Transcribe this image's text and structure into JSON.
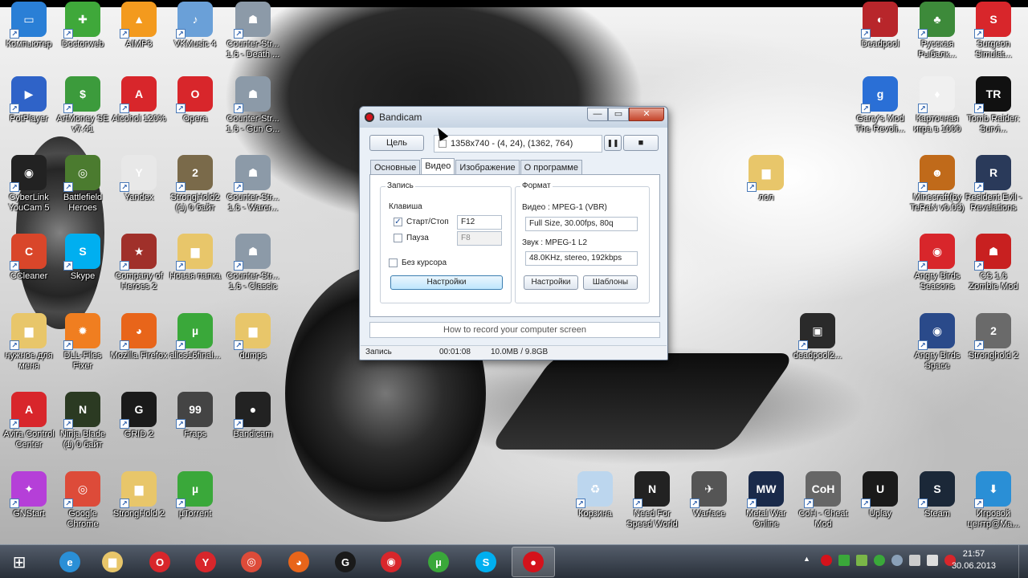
{
  "desktop": {
    "icons": [
      {
        "label": "Компьютер",
        "color": "#2a7fd6",
        "glyph": "▭"
      },
      {
        "label": "Doctorweb",
        "color": "#3fa83a",
        "glyph": "✚"
      },
      {
        "label": "AIMP3",
        "color": "#f39a1e",
        "glyph": "▲"
      },
      {
        "label": "VKMusic 4",
        "color": "#6aa0d8",
        "glyph": "♪"
      },
      {
        "label": "Counter-Str... 1.6 - Death ...",
        "color": "#8c9aa8",
        "glyph": "☗"
      },
      {
        "label": "PotPlayer",
        "color": "#2f63c8",
        "glyph": "▶"
      },
      {
        "label": "ArtMoney SE v7.41",
        "color": "#3c9b3c",
        "glyph": "$"
      },
      {
        "label": "Alcohol 120%",
        "color": "#d8262b",
        "glyph": "A"
      },
      {
        "label": "Opera",
        "color": "#d8262b",
        "glyph": "O"
      },
      {
        "label": "Counter-Str... 1.6 - Gun G...",
        "color": "#8c9aa8",
        "glyph": "☗"
      },
      {
        "label": "CyberLink YouCam 5",
        "color": "#222222",
        "glyph": "◉"
      },
      {
        "label": "Battlefield Heroes",
        "color": "#4b7b2f",
        "glyph": "◎"
      },
      {
        "label": "Yandex",
        "color": "#e8e8e8",
        "glyph": "Y"
      },
      {
        "label": "StrongHold2 (1) 0 байт",
        "color": "#7a6a4a",
        "glyph": "2"
      },
      {
        "label": "Counter-Str... 1.6 - Warcr...",
        "color": "#8c9aa8",
        "glyph": "☗"
      },
      {
        "label": "CCleaner",
        "color": "#d9462a",
        "glyph": "C"
      },
      {
        "label": "Skype",
        "color": "#00aff0",
        "glyph": "S"
      },
      {
        "label": "Company of Heroes 2",
        "color": "#a0302a",
        "glyph": "★"
      },
      {
        "label": "Новая папка",
        "color": "#e8c66a",
        "glyph": "▆"
      },
      {
        "label": "Counter-Str... 1.6 - Classic",
        "color": "#8c9aa8",
        "glyph": "☗"
      },
      {
        "label": "нужное для меня",
        "color": "#e8c66a",
        "glyph": "▆"
      },
      {
        "label": "DLL-Files Fixer",
        "color": "#f07e20",
        "glyph": "✹"
      },
      {
        "label": "Mozilla Firefox",
        "color": "#e8651a",
        "glyph": "◕"
      },
      {
        "label": "allcs16final...",
        "color": "#3aa83a",
        "glyph": "µ"
      },
      {
        "label": "dumps",
        "color": "#e8c66a",
        "glyph": "▆"
      },
      {
        "label": "Avira Control Center",
        "color": "#d8262b",
        "glyph": "A"
      },
      {
        "label": "Ninja Blade (1) 0 байт",
        "color": "#2b3a22",
        "glyph": "N"
      },
      {
        "label": "GRID 2",
        "color": "#1a1a1a",
        "glyph": "G"
      },
      {
        "label": "Fraps",
        "color": "#444444",
        "glyph": "99"
      },
      {
        "label": "Bandicam",
        "color": "#222222",
        "glyph": "●"
      },
      {
        "label": "GNStart",
        "color": "#b53fd8",
        "glyph": "✦"
      },
      {
        "label": "Google Chrome",
        "color": "#dd4b39",
        "glyph": "◎"
      },
      {
        "label": "StrongHold 2",
        "color": "#e8c66a",
        "glyph": "▆"
      },
      {
        "label": "µTorrent",
        "color": "#3aa83a",
        "glyph": "µ"
      },
      {
        "label": "Deadpool",
        "color": "#b8262b",
        "glyph": "◐"
      },
      {
        "label": "Русская Рыбалк...",
        "color": "#3d8a3a",
        "glyph": "♣"
      },
      {
        "label": "Surgeon Simulat...",
        "color": "#d8262b",
        "glyph": "S"
      },
      {
        "label": "Garry's Mod The Revoli...",
        "color": "#2a6fd6",
        "glyph": "g"
      },
      {
        "label": "Карточная игра в 1000",
        "color": "#f0f0f0",
        "glyph": "♦"
      },
      {
        "label": "Tomb Raider: Survi...",
        "color": "#111111",
        "glyph": "TR"
      },
      {
        "label": "лол",
        "color": "#e8c66a",
        "glyph": "▆"
      },
      {
        "label": "Minecraft(by TeRaN v0.03)",
        "color": "#c06a1a",
        "glyph": "☻"
      },
      {
        "label": "Resident Evil - Revelations",
        "color": "#2a3a5a",
        "glyph": "R"
      },
      {
        "label": "Angry Birds Seasons",
        "color": "#d8262b",
        "glyph": "◉"
      },
      {
        "label": "CS 1.6 Zombie Mod",
        "color": "#c82020",
        "glyph": "☗"
      },
      {
        "label": "deadpool2...",
        "color": "#2a2a2a",
        "glyph": "▣"
      },
      {
        "label": "Angry Birds Space",
        "color": "#2a4a8a",
        "glyph": "◉"
      },
      {
        "label": "Stronghold 2",
        "color": "#6a6a6a",
        "glyph": "2"
      },
      {
        "label": "Корзина",
        "color": "#bcd6ee",
        "glyph": "♻"
      },
      {
        "label": "Need For Speed World",
        "color": "#222222",
        "glyph": "N"
      },
      {
        "label": "Warface",
        "color": "#555555",
        "glyph": "✈"
      },
      {
        "label": "Metal War Online",
        "color": "#1a2a4a",
        "glyph": "MW"
      },
      {
        "label": "CoH - Cheat Mod",
        "color": "#666666",
        "glyph": "CoH"
      },
      {
        "label": "Uplay",
        "color": "#1a1a1a",
        "glyph": "U"
      },
      {
        "label": "Steam",
        "color": "#1b2838",
        "glyph": "S"
      },
      {
        "label": "Игровой центр@Ma...",
        "color": "#2a8fd6",
        "glyph": "⬇"
      }
    ]
  },
  "bandicam": {
    "title": "Bandicam",
    "min_label": "—",
    "max_label": "▭",
    "close_label": "✕",
    "target_button": "Цель",
    "region_text": "1358x740 - (4, 24), (1362, 764)",
    "pause_icon": "❚❚",
    "stop_icon": "■",
    "tabs": [
      "Основные",
      "Видео",
      "Изображение",
      "О программе"
    ],
    "active_tab": "Видео",
    "record_group": {
      "title": "Запись",
      "hotkey_label": "Клавиша",
      "start_stop_label": "Старт/Стоп",
      "start_stop_checked": "✓",
      "start_stop_key": "F12",
      "pause_label": "Пауза",
      "pause_key": "F8",
      "no_cursor_label": "Без курсора",
      "settings_button": "Настройки"
    },
    "format_group": {
      "title": "Формат",
      "video_label": "Видео : MPEG-1 (VBR)",
      "video_value": "Full Size, 30.00fps, 80q",
      "audio_label": "Звук : MPEG-1 L2",
      "audio_value": "48.0KHz, stereo, 192kbps",
      "settings_button": "Настройки",
      "templates_button": "Шаблоны"
    },
    "howto_link": "How to record your computer screen",
    "status": {
      "state": "Запись",
      "time": "00:01:08",
      "size": "10.0MB / 9.8GB"
    }
  },
  "taskbar": {
    "start_icon": "⊞",
    "items": [
      {
        "name": "ie",
        "glyph": "e",
        "color": "#2a8fd6"
      },
      {
        "name": "explorer",
        "glyph": "▆",
        "color": "#e8c66a"
      },
      {
        "name": "opera",
        "glyph": "O",
        "color": "#d8262b"
      },
      {
        "name": "yandex",
        "glyph": "Y",
        "color": "#d8262b"
      },
      {
        "name": "chrome",
        "glyph": "◎",
        "color": "#dd4b39"
      },
      {
        "name": "firefox",
        "glyph": "◕",
        "color": "#e8651a"
      },
      {
        "name": "grid2",
        "glyph": "G",
        "color": "#1a1a1a"
      },
      {
        "name": "angry-birds",
        "glyph": "◉",
        "color": "#d8262b"
      },
      {
        "name": "utorrent",
        "glyph": "µ",
        "color": "#3aa83a"
      },
      {
        "name": "skype",
        "glyph": "S",
        "color": "#00aff0"
      },
      {
        "name": "bandicam",
        "glyph": "●",
        "color": "#d4121b"
      }
    ],
    "tray_arrow": "▲",
    "time": "21:57",
    "date": "30.06.2013"
  }
}
